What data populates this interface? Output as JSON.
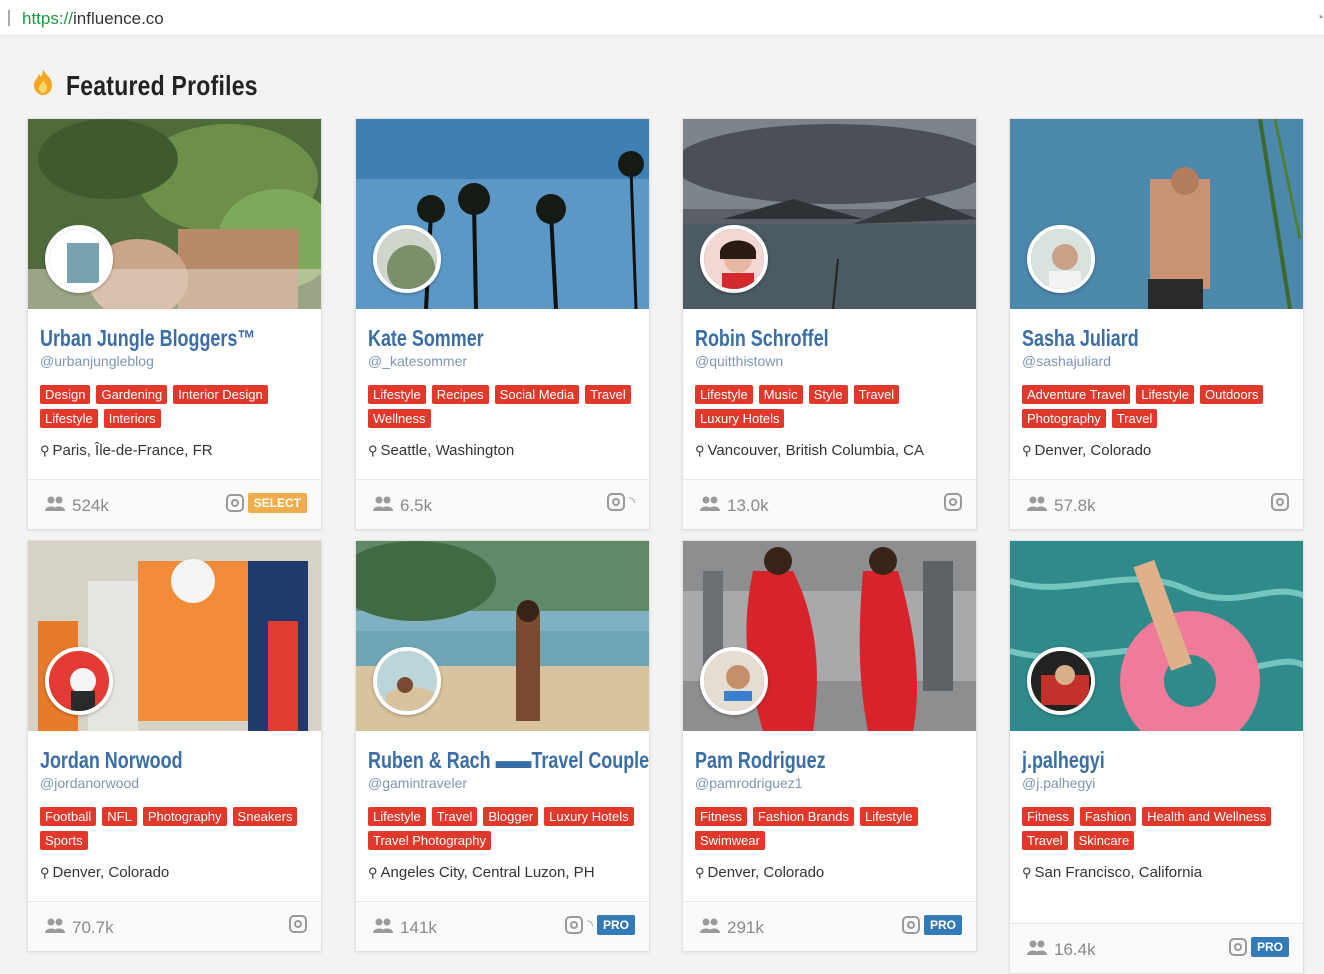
{
  "browser": {
    "url_scheme": "https://",
    "url_host": "influence.co"
  },
  "section": {
    "title": "Featured Profiles",
    "icon": "fire-icon"
  },
  "profiles": [
    {
      "name": "Urban Jungle Bloggers™",
      "handle": "@urbanjungleblog",
      "tags": [
        "Design",
        "Gardening",
        "Interior Design",
        "Lifestyle",
        "Interiors"
      ],
      "location": "Paris, Île-de-France, FR",
      "followers": "524k",
      "badge": "SELECT",
      "socials": [
        "instagram"
      ]
    },
    {
      "name": "Kate Sommer",
      "handle": "@_katesommer",
      "tags": [
        "Lifestyle",
        "Recipes",
        "Social Media",
        "Travel",
        "Wellness"
      ],
      "location": "Seattle, Washington",
      "followers": "6.5k",
      "badge": "",
      "socials": [
        "instagram",
        "rss"
      ]
    },
    {
      "name": "Robin Schroffel",
      "handle": "@quitthistown",
      "tags": [
        "Lifestyle",
        "Music",
        "Style",
        "Travel",
        "Luxury Hotels"
      ],
      "location": "Vancouver, British Columbia, CA",
      "followers": "13.0k",
      "badge": "",
      "socials": [
        "instagram"
      ]
    },
    {
      "name": "Sasha Juliard",
      "handle": "@sashajuliard",
      "tags": [
        "Adventure Travel",
        "Lifestyle",
        "Outdoors",
        "Photography",
        "Travel"
      ],
      "location": "Denver, Colorado",
      "followers": "57.8k",
      "badge": "",
      "socials": [
        "instagram"
      ]
    },
    {
      "name": "Jordan Norwood",
      "handle": "@jordanorwood",
      "tags": [
        "Football",
        "NFL",
        "Photography",
        "Sneakers",
        "Sports"
      ],
      "location": "Denver, Colorado",
      "followers": "70.7k",
      "badge": "",
      "socials": [
        "instagram"
      ]
    },
    {
      "name": "Ruben & Rach ▬▬Travel Couple",
      "handle": "@gamintraveler",
      "tags": [
        "Lifestyle",
        "Travel",
        "Blogger",
        "Luxury Hotels",
        "Travel Photography"
      ],
      "location": "Angeles City, Central Luzon, PH",
      "followers": "141k",
      "badge": "PRO",
      "socials": [
        "instagram",
        "rss"
      ]
    },
    {
      "name": "Pam Rodriguez",
      "handle": "@pamrodriguez1",
      "tags": [
        "Fitness",
        "Fashion Brands",
        "Lifestyle",
        "Swimwear"
      ],
      "location": "Denver, Colorado",
      "followers": "291k",
      "badge": "PRO",
      "socials": [
        "instagram"
      ]
    },
    {
      "name": "j.palhegyi",
      "handle": "@j.palhegyi",
      "tags": [
        "Fitness",
        "Fashion",
        "Health and Wellness",
        "Travel",
        "Skincare"
      ],
      "location": "San Francisco, California",
      "followers": "16.4k",
      "badge": "PRO",
      "socials": [
        "instagram"
      ]
    }
  ]
}
